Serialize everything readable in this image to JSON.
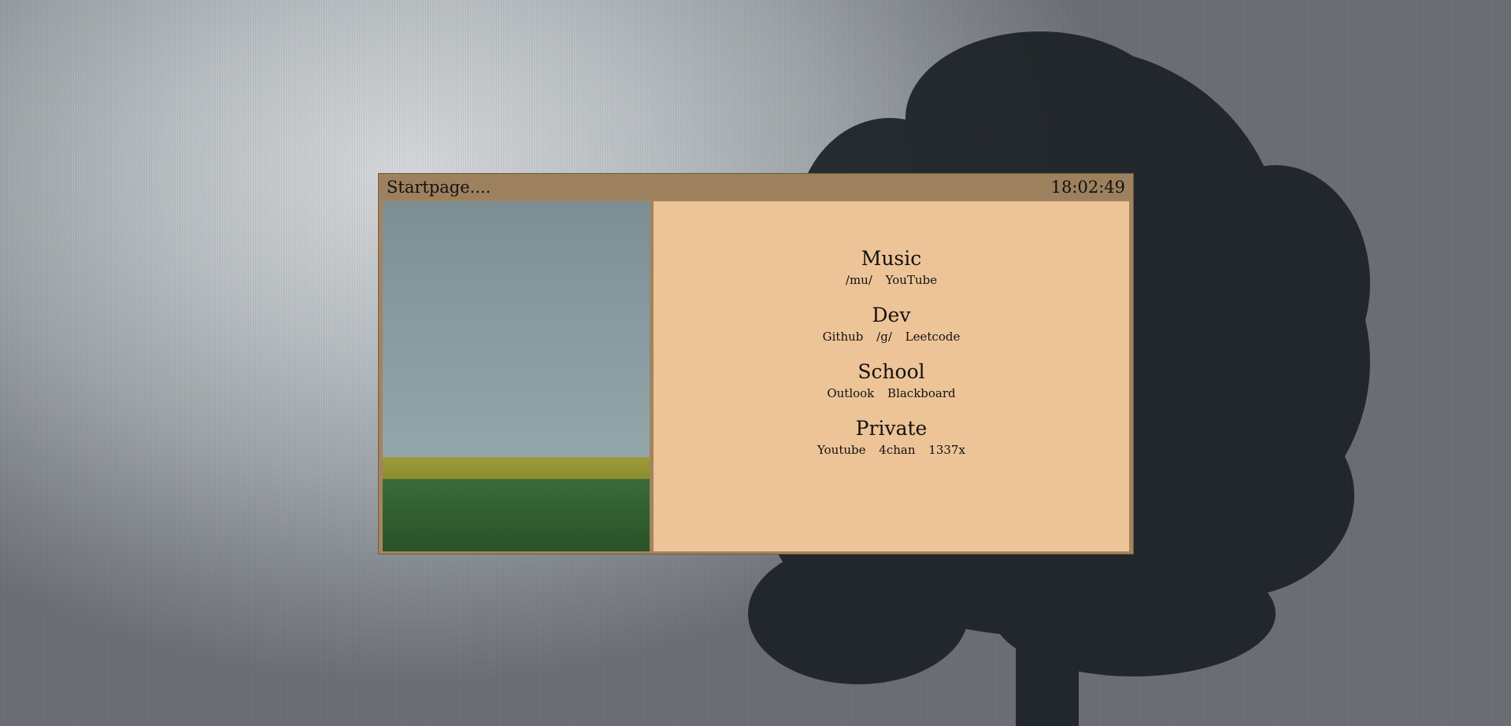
{
  "window": {
    "title": "Startpage....",
    "clock": "18:02:49"
  },
  "sections": [
    {
      "title": "Music",
      "links": [
        "/mu/",
        "YouTube"
      ]
    },
    {
      "title": "Dev",
      "links": [
        "Github",
        "/g/",
        "Leetcode"
      ]
    },
    {
      "title": "School",
      "links": [
        "Outlook",
        "Blackboard"
      ]
    },
    {
      "title": "Private",
      "links": [
        "Youtube",
        "4chan",
        "1337x"
      ]
    }
  ],
  "colors": {
    "titlebar": "#9d805e",
    "panel": "#edc497",
    "window_border": "#a3845f"
  },
  "images": {
    "background": "tree-silhouette-wallpaper",
    "sidebar": "landscape-field-sky"
  }
}
